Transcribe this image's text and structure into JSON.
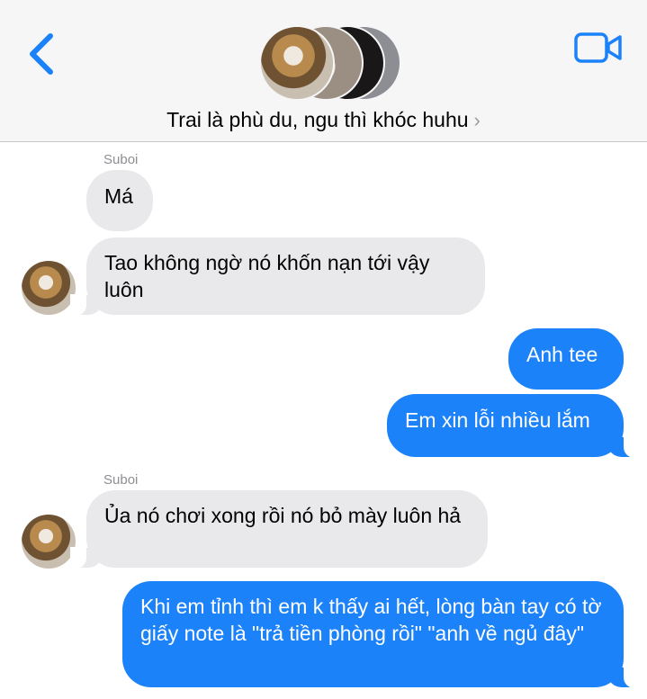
{
  "header": {
    "title": "Trai là phù du, ngu thì khóc huhu",
    "chevron": "›",
    "accent_color": "#1b82f9"
  },
  "messages": [
    {
      "direction": "incoming",
      "sender": "Suboi",
      "text": "Má"
    },
    {
      "direction": "incoming",
      "text": "Tao không ngờ nó khốn nạn tới vậy luôn"
    },
    {
      "direction": "outgoing",
      "text": "Anh tee"
    },
    {
      "direction": "outgoing",
      "text": "Em xin lỗi nhiều lắm"
    },
    {
      "direction": "incoming",
      "sender": "Suboi",
      "text": "Ủa nó chơi xong rồi nó bỏ mày luôn hả"
    },
    {
      "direction": "outgoing",
      "text": "Khi em tỉnh thì em k thấy ai hết, lòng bàn tay có tờ giấy note là \"trả tiền phòng rồi\" \"anh về ngủ đây\""
    }
  ],
  "colors": {
    "incoming_bubble": "#e9e9eb",
    "outgoing_bubble": "#1b82f9",
    "header_bg": "#f6f6f7",
    "sender_label": "#8e8e93"
  },
  "icons": [
    "back-chevron-icon",
    "video-call-icon",
    "group-avatar-stack",
    "contact-avatar"
  ]
}
